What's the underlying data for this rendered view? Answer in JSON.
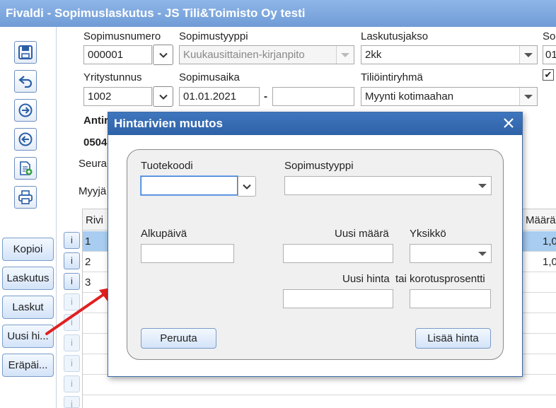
{
  "window": {
    "title": "Fivaldi - Sopimuslaskutus - JS Tili&Toimisto Oy testi"
  },
  "toolbar": {
    "icons": [
      "save-icon",
      "undo-icon",
      "next-icon",
      "previous-icon",
      "new-document-icon",
      "print-icon"
    ]
  },
  "side_buttons": {
    "kopioi": "Kopioi",
    "laskutus": "Laskutus",
    "laskut": "Laskut",
    "uusi_hinta": "Uusi hi...",
    "erapaiva": "Eräpäi..."
  },
  "form": {
    "sopimusnumero_label": "Sopimusnumero",
    "sopimusnumero_value": "000001",
    "sopimustyyppi_label": "Sopimustyyppi",
    "sopimustyyppi_value": "Kuukausittainen-kirjanpito",
    "laskutusjakso_label": "Laskutusjakso",
    "laskutusjakso_value": "2kk",
    "so_label_partial": "So",
    "so_value_partial": "01",
    "yritystunnus_label": "Yritystunnus",
    "yritystunnus_value": "1002",
    "sopimusaika_label": "Sopimusaika",
    "sopimusaika_start": "01.01.2021",
    "sopimusaika_separator": "-",
    "sopimusaika_end": "",
    "tiliointiryhma_label": "Tiliöintiryhmä",
    "tiliointiryhma_value": "Myynti kotimaahan",
    "customer_name_partial": "Antir",
    "phone_partial": "0504",
    "seura_partial": "Seura",
    "myyja_partial": "Myyjä"
  },
  "grid": {
    "header_rivi": "Rivi",
    "header_maara": "Määrä",
    "rows": [
      {
        "rivi": "1",
        "maara": "1,0"
      },
      {
        "rivi": "2",
        "maara": "1,0"
      },
      {
        "rivi": "3",
        "maara": ""
      }
    ],
    "info_label": "i"
  },
  "modal": {
    "title": "Hintarivien muutos",
    "tuotekoodi_label": "Tuotekoodi",
    "sopimustyyppi_label": "Sopimustyyppi",
    "alkupaiva_label": "Alkupäivä",
    "uusi_maara_label": "Uusi määrä",
    "yksikko_label": "Yksikkö",
    "uusi_hinta_label": "Uusi hinta",
    "korotusprosentti_label": "tai korotusprosentti",
    "cancel_label": "Peruuta",
    "add_price_label": "Lisää hinta"
  },
  "colors": {
    "titlebar": "#7aa5de",
    "modal_titlebar": "#3568ae",
    "selected_row": "#a8cdf0",
    "annotation_arrow": "#e02020"
  }
}
